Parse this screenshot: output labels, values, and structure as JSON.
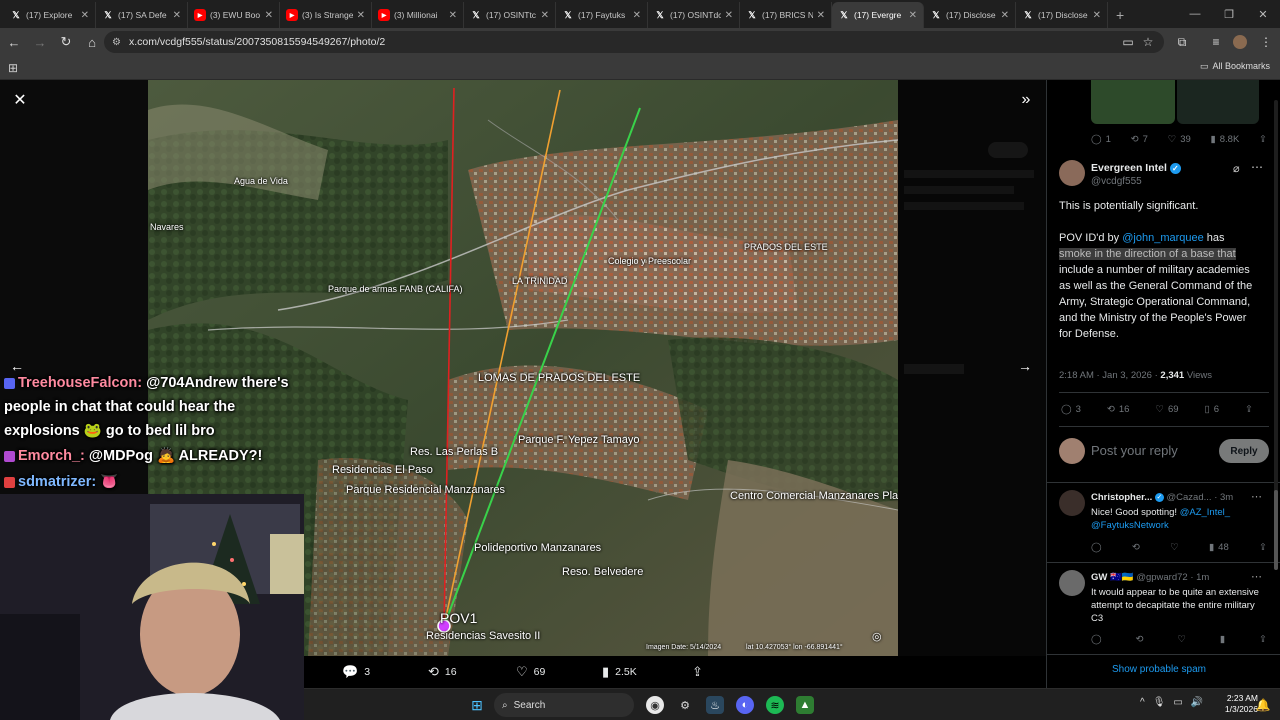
{
  "browser": {
    "tabs": [
      {
        "label": "(17) Explore",
        "icon": "x-icon"
      },
      {
        "label": "(17) SA Defe",
        "icon": "x-icon"
      },
      {
        "label": "(3) EWU Boo",
        "icon": "youtube-icon"
      },
      {
        "label": "(3) Is Strange",
        "icon": "youtube-icon"
      },
      {
        "label": "(3) Millionai",
        "icon": "youtube-icon"
      },
      {
        "label": "(17) OSINTtc",
        "icon": "x-icon"
      },
      {
        "label": "(17) Faytuks",
        "icon": "x-icon"
      },
      {
        "label": "(17) OSINTdc",
        "icon": "x-icon"
      },
      {
        "label": "(17) BRICS N",
        "icon": "x-icon"
      },
      {
        "label": "(17) Evergre",
        "icon": "x-icon",
        "active": true
      },
      {
        "label": "(17) Disclose",
        "icon": "x-icon"
      },
      {
        "label": "(17) Disclose",
        "icon": "x-icon"
      }
    ],
    "url": "x.com/vcdgf555/status/2007350815594549267/photo/2",
    "all_bookmarks": "All Bookmarks"
  },
  "photo": {
    "labels": {
      "lomas": "LOMAS DE PRADOS DEL ESTE",
      "parque_yepez": "Parque F. Yepez Tamayo",
      "las_perlas": "Res. Las Perlas B",
      "el_paso": "Residencias El Paso",
      "manzanares": "Parque Residencial Manzanares",
      "centro_comercial": "Centro Comercial Manzanares Plaza",
      "polideportivo": "Polideportivo Manzanares",
      "belvedere": "Reso. Belvedere",
      "savesito": "Residencias Savesito II",
      "pov": "POV1",
      "parque_armas": "Parque de armas FANB (CALIFA)",
      "agua_vida": "Agua de Vida",
      "navarres": "Navares",
      "prados_este": "PRADOS DEL ESTE",
      "la_trinidad": "LA TRINIDAD",
      "colegio": "Colegio y Preescolar",
      "image_date": "Imagen Date: 5/14/2024",
      "coords": "lat 10.427053° lon -66.891441°"
    },
    "colors": {
      "red_line": "#e02020",
      "orange_line": "#f0a030",
      "green_line": "#39d24a"
    }
  },
  "chat": [
    {
      "user": "TreehouseFalcon:",
      "text": "@704Andrew there's",
      "badge": "#5865f2"
    },
    {
      "user": "",
      "text": "people in chat that could hear the",
      "badge": ""
    },
    {
      "user": "",
      "text": "explosions 🐸 go to bed lil bro",
      "badge": ""
    },
    {
      "user": "Emorch_:",
      "text": "@MDPog 🙇 ALREADY?!",
      "badge": "#b04ad0"
    },
    {
      "user": "sdmatrizer:",
      "text": "👅",
      "badge": "#e04040"
    }
  ],
  "photo_actions": {
    "replies": "3",
    "reposts": "16",
    "likes": "69",
    "views": "2.5K"
  },
  "sidebar": {
    "prev_stats": {
      "replies": "1",
      "reposts": "7",
      "likes": "39",
      "views": "8.8K"
    },
    "author_name": "Evergreen Intel",
    "author_handle": "@vcdgf555",
    "post": {
      "line1": "This is potentially significant.",
      "pov_prefix": "POV ID'd by ",
      "mention": "@john_marquee",
      "pov_suffix": " has",
      "highlighted": "smoke in the direction of a base that",
      "rest": "include a number of military academies as well as the General Command of the Army, Strategic Operational Command, and the Ministry of the People's Power for Defense."
    },
    "timestamp": "2:18 AM · Jan 3, 2026 · ",
    "views_count": "2,341",
    "views_label": "Views",
    "post_stats": {
      "replies": "3",
      "reposts": "16",
      "likes": "69",
      "bookmarks": "6"
    },
    "reply_placeholder": "Post your reply",
    "reply_button": "Reply",
    "replies": [
      {
        "name": "Christopher...",
        "handle": "@Cazad...",
        "time": "· 3m",
        "text_plain": "Nice! Good spotting! ",
        "mentions": "@AZ_Intel_ @FaytuksNetwork",
        "views": "48"
      },
      {
        "name": "GW",
        "flags": "🇦🇺🇺🇦",
        "handle": "@gpward72",
        "time": "· 1m",
        "text_plain": "It would appear to be quite an extensive attempt to decapitate the entire military C3",
        "mentions": "",
        "views": ""
      }
    ],
    "show_spam": "Show probable spam"
  },
  "taskbar": {
    "search_label": "Search",
    "time": "2:23 AM",
    "date": "1/3/2026"
  }
}
